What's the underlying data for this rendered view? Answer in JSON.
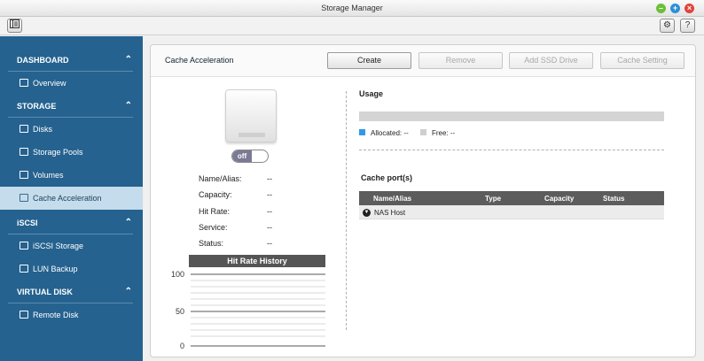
{
  "window": {
    "title": "Storage Manager"
  },
  "toolbar": {
    "settings_icon": "gear-icon",
    "help_label": "?"
  },
  "sidebar": {
    "sections": [
      {
        "label": "DASHBOARD",
        "items": [
          {
            "label": "Overview"
          }
        ]
      },
      {
        "label": "STORAGE",
        "items": [
          {
            "label": "Disks"
          },
          {
            "label": "Storage Pools"
          },
          {
            "label": "Volumes"
          },
          {
            "label": "Cache Acceleration"
          }
        ]
      },
      {
        "label": "iSCSI",
        "items": [
          {
            "label": "iSCSI Storage"
          },
          {
            "label": "LUN Backup"
          }
        ]
      },
      {
        "label": "VIRTUAL DISK",
        "items": [
          {
            "label": "Remote Disk"
          }
        ]
      }
    ],
    "active_item": "Cache Acceleration"
  },
  "main": {
    "title": "Cache Acceleration",
    "buttons": {
      "create": "Create",
      "remove": "Remove",
      "add_ssd": "Add SSD Drive",
      "cache_setting": "Cache Setting"
    },
    "toggle": {
      "label": "off"
    },
    "info": {
      "name_label": "Name/Alias:",
      "name_value": "--",
      "capacity_label": "Capacity:",
      "capacity_value": "--",
      "hitrate_label": "Hit Rate:",
      "hitrate_value": "--",
      "service_label": "Service:",
      "service_value": "--",
      "status_label": "Status:",
      "status_value": "--"
    },
    "chart": {
      "title": "Hit Rate History",
      "ticks": [
        "100",
        "50",
        "0"
      ]
    },
    "usage": {
      "title": "Usage",
      "allocated_label": "Allocated: --",
      "free_label": "Free: --",
      "allocated_color": "#2e9be6",
      "free_color": "#cfcfcf"
    },
    "cache_ports": {
      "title": "Cache port(s)",
      "columns": [
        "Name/Alias",
        "Type",
        "Capacity",
        "Status"
      ],
      "rows": [
        {
          "name": "NAS Host"
        }
      ]
    }
  },
  "colors": {
    "sidebar": "#25628f",
    "sidebar_active": "#c4dceb"
  }
}
